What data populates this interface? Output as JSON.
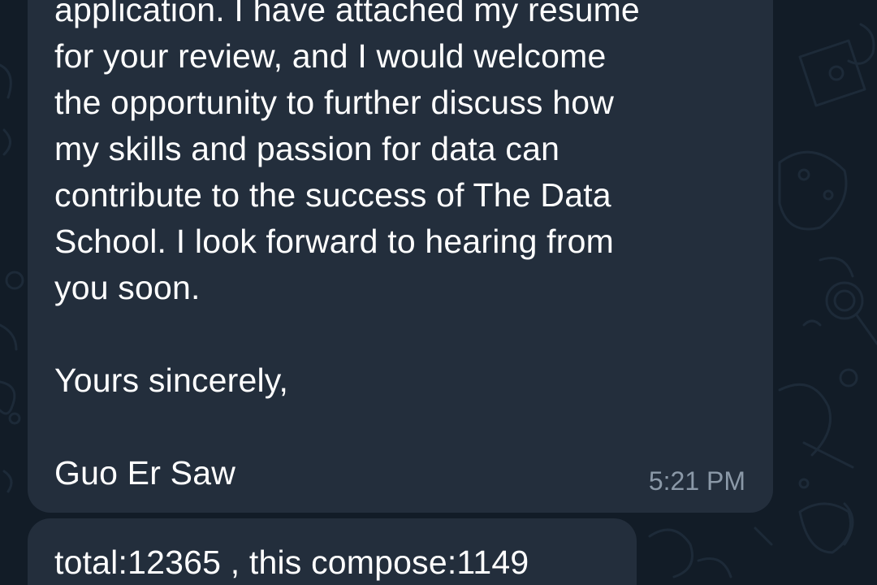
{
  "messages": [
    {
      "text": "application. I have attached my resume\nfor your review, and I would welcome\nthe opportunity to further discuss how\nmy skills and passion for data can\ncontribute to the success of The Data\nSchool. I look forward to hearing from\nyou soon.\n\nYours sincerely,\n\nGuo Er Saw",
      "time": "5:21 PM"
    },
    {
      "text": "total:12365 , this compose:1149"
    }
  ],
  "colors": {
    "background": "#121c27",
    "bubble": "#232e3c",
    "text": "#ffffff",
    "timestamp": "#8b99a8"
  }
}
